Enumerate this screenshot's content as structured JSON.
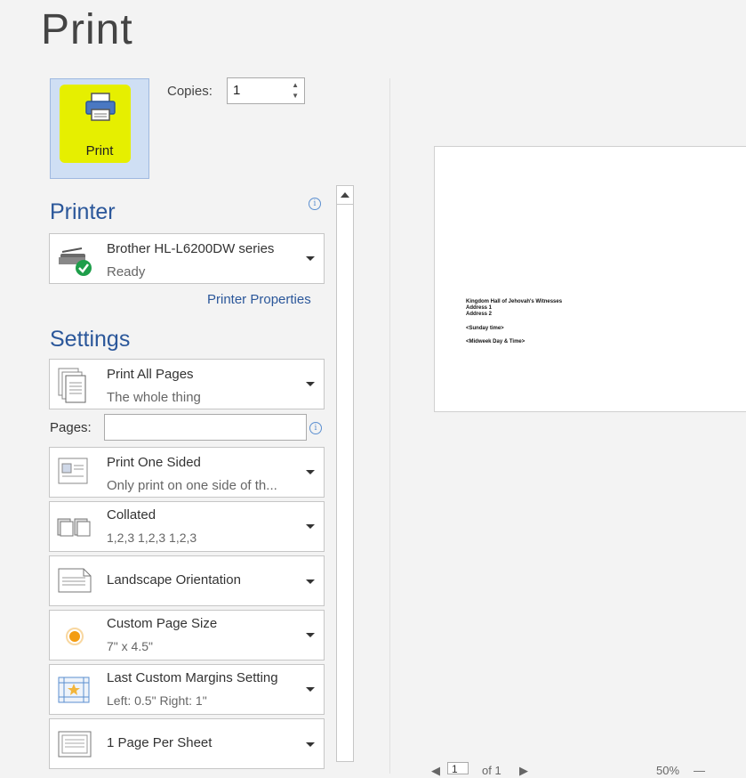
{
  "title": "Print",
  "print_button": {
    "label": "Print"
  },
  "copies": {
    "label": "Copies:",
    "value": "1"
  },
  "printer": {
    "heading": "Printer",
    "name": "Brother HL-L6200DW series",
    "status": "Ready",
    "properties_link": "Printer Properties"
  },
  "settings": {
    "heading": "Settings",
    "pages_label": "Pages:",
    "pages_value": "",
    "items": [
      {
        "title": "Print All Pages",
        "subtitle": "The whole thing"
      },
      {
        "title": "Print One Sided",
        "subtitle": "Only print on one side of th..."
      },
      {
        "title": "Collated",
        "subtitle": "1,2,3    1,2,3    1,2,3"
      },
      {
        "title": "Landscape Orientation",
        "subtitle": ""
      },
      {
        "title": "Custom Page Size",
        "subtitle": "7\" x 4.5\""
      },
      {
        "title": "Last Custom Margins Setting",
        "subtitle": "Left:  0.5\"    Right:  1\""
      },
      {
        "title": "1 Page Per Sheet",
        "subtitle": ""
      }
    ]
  },
  "preview": {
    "lines": [
      "Kingdom Hall of Jehovah's Witnesses",
      "Address 1",
      "Address 2",
      "<Sunday time>",
      "<Midweek Day & Time>"
    ],
    "page_current": "1",
    "page_of": "of 1",
    "zoom": "50%"
  },
  "colors": {
    "accent": "#2b579a",
    "highlight": "#e6ef00",
    "button_bg": "#cfdff4"
  }
}
